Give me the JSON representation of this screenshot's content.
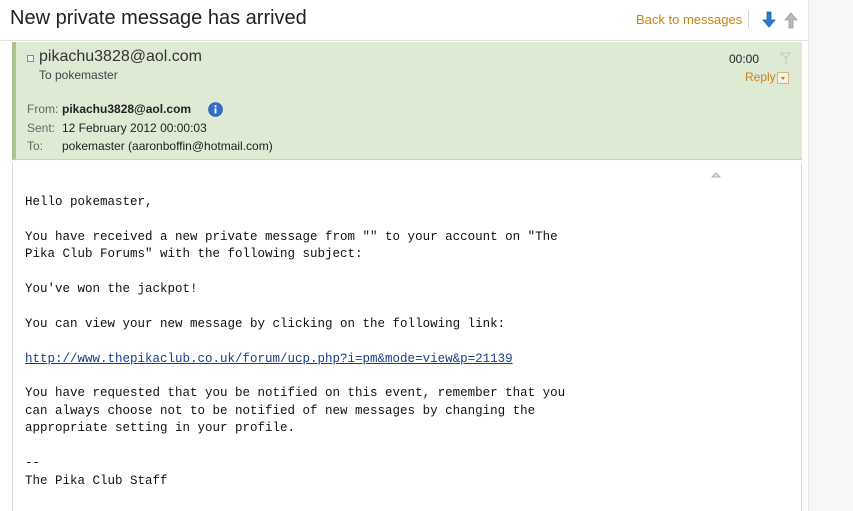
{
  "header": {
    "title": "New private message has arrived",
    "back_link": "Back to messages",
    "next_icon": "arrow-down-icon",
    "prev_icon": "arrow-up-icon"
  },
  "message_header": {
    "sender": "pikachu3828@aol.com",
    "to_line": "To pokemaster",
    "time": "00:00",
    "reply_label": "Reply",
    "from_label": "From:",
    "from_value": "pikachu3828@aol.com",
    "sent_label": "Sent:",
    "sent_value": "12 February 2012 00:00:03",
    "to_label": "To:",
    "to_value": "pokemaster (aaronboffin@hotmail.com)"
  },
  "message_body": {
    "greeting": "Hello pokemaster,",
    "line1": "You have received a new private message from \"\" to your account on \"The",
    "line2": "Pika Club Forums\" with the following subject:",
    "subject": "You've won the jackpot!",
    "view_line": "You can view your new message by clicking on the following link:",
    "link": "http://www.thepikaclub.co.uk/forum/ucp.php?i=pm&mode=view&p=21139",
    "notify1": "You have requested that you be notified on this event, remember that you",
    "notify2": "can always choose not to be notified of new messages by changing the",
    "notify3": "appropriate setting in your profile.",
    "sig_sep": "--",
    "signature": "The Pika Club Staff"
  },
  "colors": {
    "header_bg": "#dfead5",
    "accent_link": "#c8821a",
    "body_link": "#1a3f8a",
    "nav_arrow": "#2b7bd1",
    "info_icon": "#2f6fc9"
  }
}
